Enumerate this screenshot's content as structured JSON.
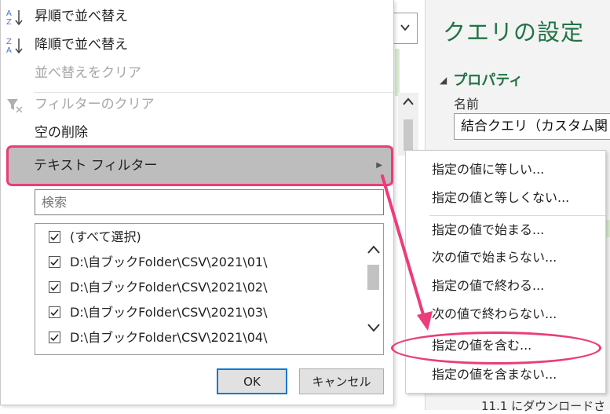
{
  "menu": {
    "sort_asc": "昇順で並べ替え",
    "sort_desc": "降順で並べ替え",
    "clear_sort": "並べ替えをクリア",
    "clear_filter": "フィルターのクリア",
    "remove_empty": "空の削除",
    "text_filter": "テキスト フィルター",
    "sort_asc_icon": "sort-ascending-icon",
    "sort_desc_icon": "sort-descending-icon",
    "clear_filter_icon": "filter-clear-icon"
  },
  "search": {
    "placeholder": "検索"
  },
  "list": {
    "items": [
      {
        "label": "(すべて選択)",
        "checked": true
      },
      {
        "label": "D:\\自ブックFolder\\CSV\\2021\\01\\",
        "checked": true
      },
      {
        "label": "D:\\自ブックFolder\\CSV\\2021\\02\\",
        "checked": true
      },
      {
        "label": "D:\\自ブックFolder\\CSV\\2021\\03\\",
        "checked": true
      },
      {
        "label": "D:\\自ブックFolder\\CSV\\2021\\04\\",
        "checked": true
      }
    ]
  },
  "buttons": {
    "ok": "OK",
    "cancel": "キャンセル"
  },
  "submenu": {
    "items": [
      "指定の値に等しい...",
      "指定の値と等しくない...",
      "指定の値で始まる...",
      "次の値で始まらない...",
      "指定の値で終わる...",
      "次の値で終わらない...",
      "指定の値を含む...",
      "指定の値を含まない..."
    ]
  },
  "settings": {
    "title": "クエリの設定",
    "properties": "プロパティ",
    "name_label": "名前",
    "name_value": "結合クエリ（カスタム関"
  },
  "bottom_text": "11.1 にダウンロードさ",
  "colors": {
    "highlight_border": "#ea3d7a",
    "accent_green": "#217346",
    "ok_border": "#0078d7"
  }
}
